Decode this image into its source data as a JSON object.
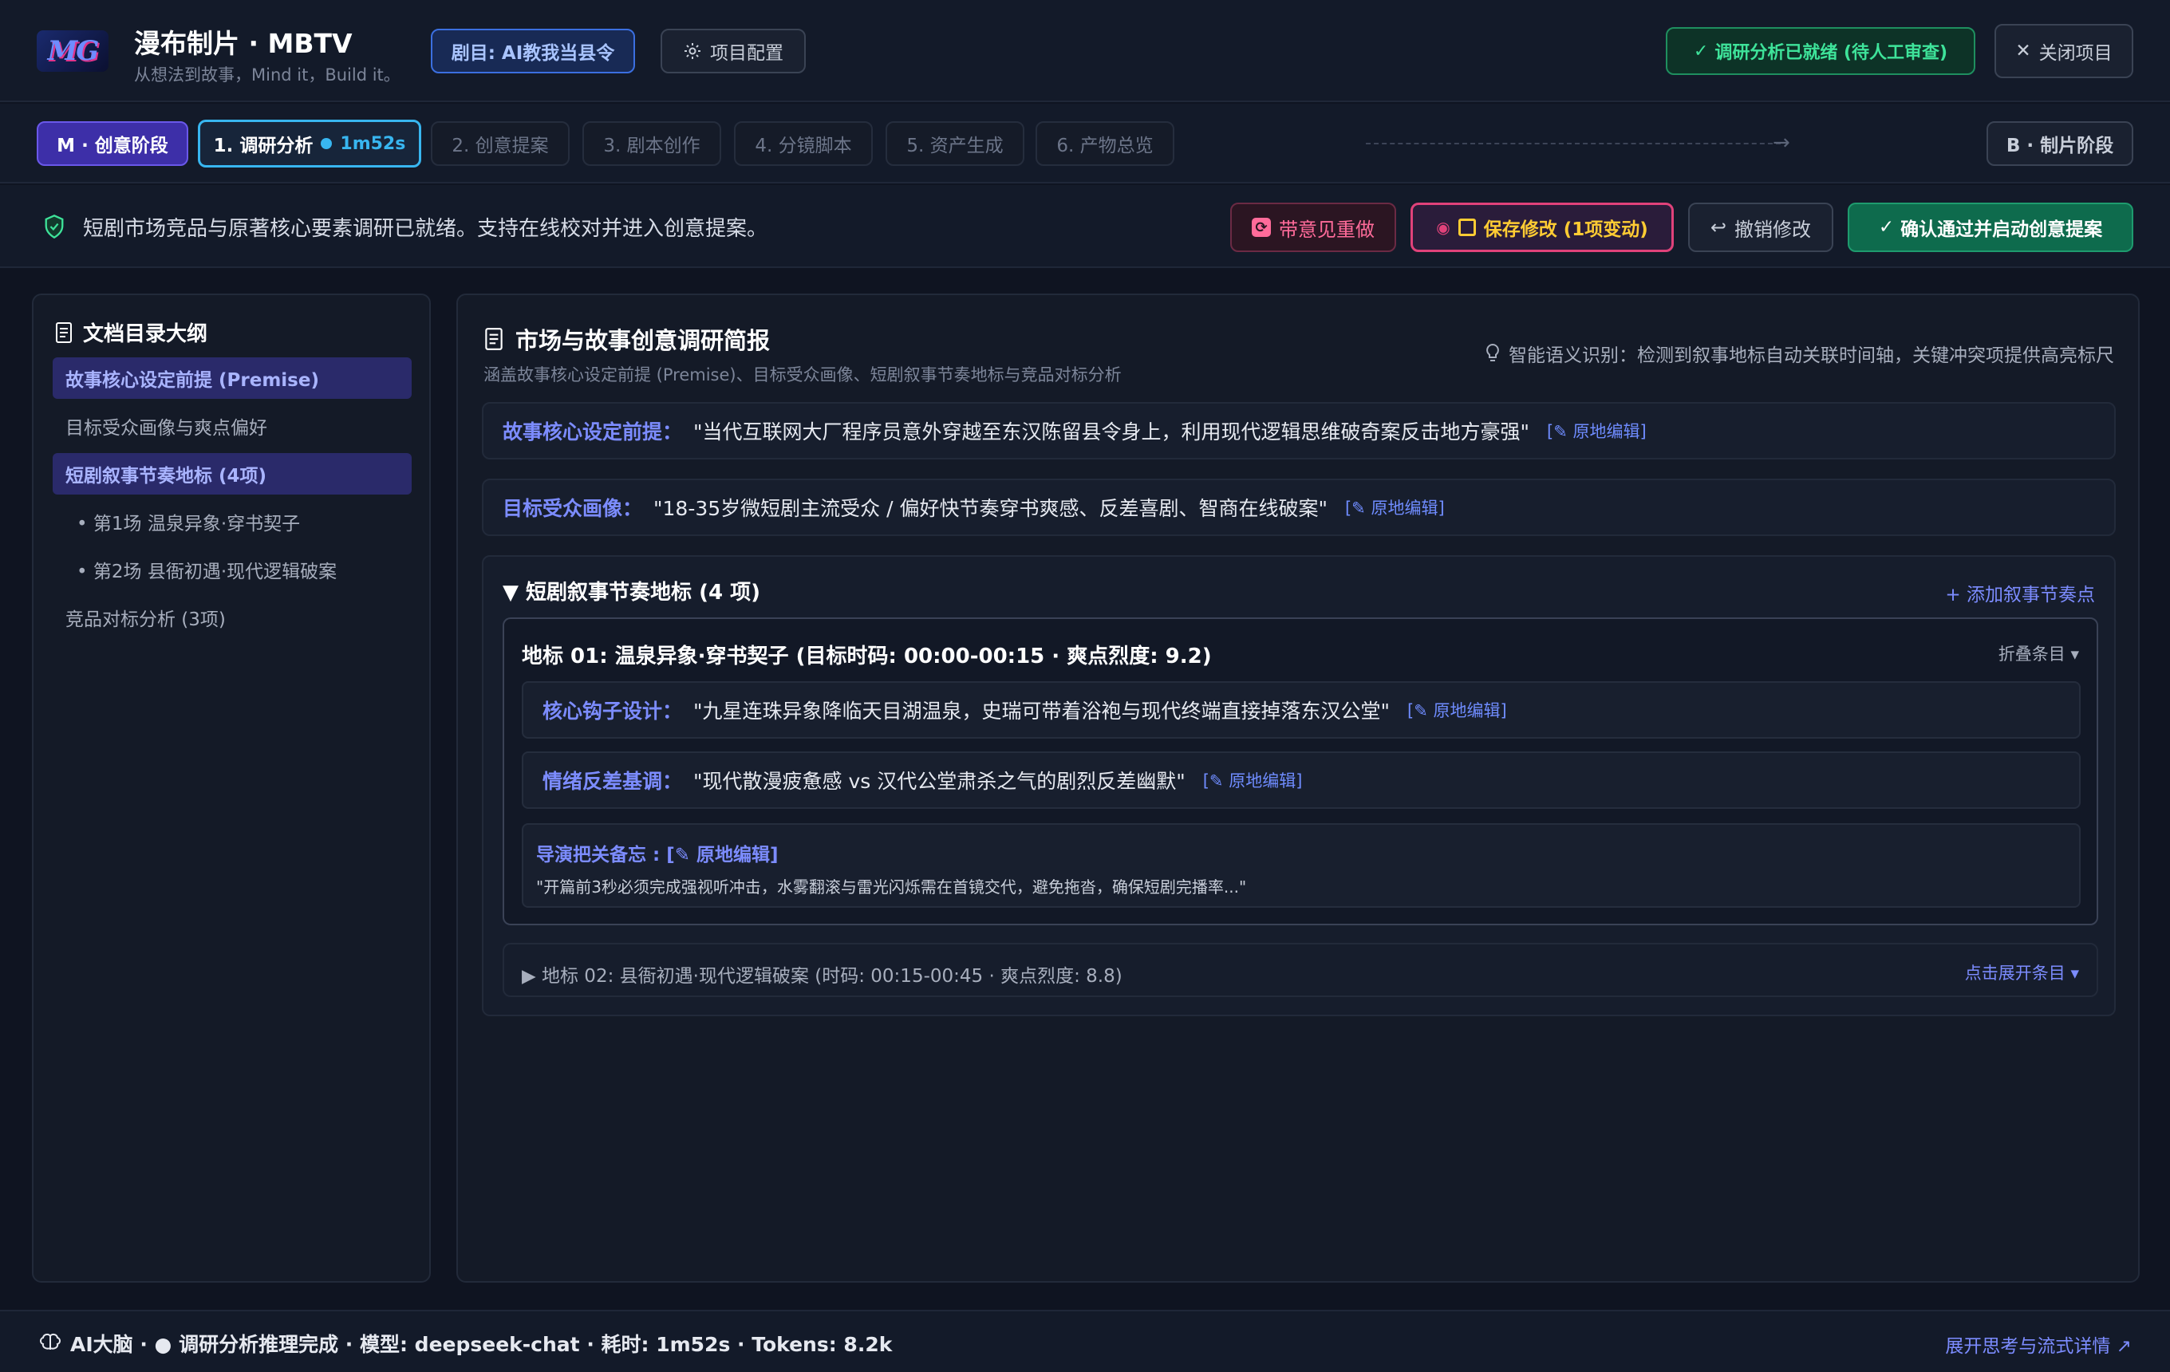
{
  "header": {
    "logo": "MG",
    "app_title": "漫布制片 · MBTV",
    "app_subtitle": "从想法到故事，Mind it，Build it。",
    "project_badge": "剧目: AI教我当县令",
    "config_label": "项目配置",
    "ready_badge": "调研分析已就绪 (待人工审查)",
    "close_label": "关闭项目"
  },
  "stages": {
    "m_stage": "M · 创意阶段",
    "active_step": {
      "label": "1. 调研分析",
      "timer": "1m52s"
    },
    "steps": [
      "2. 创意提案",
      "3. 剧本创作",
      "4. 分镜脚本",
      "5. 资产生成",
      "6. 产物总览"
    ],
    "b_stage": "B · 制片阶段"
  },
  "notice": {
    "text": "短剧市场竞品与原著核心要素调研已就绪。支持在线校对并进入创意提案。",
    "redo": "带意见重做",
    "save": "保存修改 (1项变动)",
    "undo": "撤销修改",
    "confirm": "确认通过并启动创意提案"
  },
  "sidebar": {
    "title": "文档目录大纲",
    "items": [
      "故事核心设定前提 (Premise)",
      "目标受众画像与爽点偏好",
      "短剧叙事节奏地标 (4项)",
      "• 第1场 温泉异象·穿书契子",
      "• 第2场 县衙初遇·现代逻辑破案",
      "竞品对标分析 (3项)"
    ]
  },
  "main": {
    "title": "市场与故事创意调研简报",
    "subtitle": "涵盖故事核心设定前提 (Premise)、目标受众画像、短剧叙事节奏地标与竞品对标分析",
    "ai_hint": "智能语义识别：检测到叙事地标自动关联时间轴，关键冲突项提供高亮标尺",
    "edit_label": "[✎ 原地编辑]",
    "premise": {
      "label": "故事核心设定前提：",
      "value": "\"当代互联网大厂程序员意外穿越至东汉陈留县令身上，利用现代逻辑思维破奇案反击地方豪强\""
    },
    "audience": {
      "label": "目标受众画像：",
      "value": "\"18-35岁微短剧主流受众 / 偏好快节奏穿书爽感、反差喜剧、智商在线破案\""
    },
    "beats": {
      "title": "▼ 短剧叙事节奏地标 (4 项)",
      "add": "+ 添加叙事节奏点",
      "beat1": {
        "title": "地标 01: 温泉异象·穿书契子 (目标时码: 00:00-00:15 · 爽点烈度: 9.2)",
        "collapse": "折叠条目 ▾",
        "hook_label": "核心钩子设计：",
        "hook_value": "\"九星连珠异象降临天目湖温泉，史瑞可带着浴袍与现代终端直接掉落东汉公堂\"",
        "contrast_label": "情绪反差基调：",
        "contrast_value": "\"现代散漫疲惫感 vs 汉代公堂肃杀之气的剧烈反差幽默\"",
        "memo_title": "导演把关备忘 : [✎ 原地编辑]",
        "memo_text": "\"开篇前3秒必须完成强视听冲击，水雾翻滚与雷光闪烁需在首镜交代，避免拖沓，确保短剧完播率...\""
      },
      "beat2": {
        "title": "▶ 地标 02: 县衙初遇·现代逻辑破案 (时码: 00:15-00:45 · 爽点烈度: 8.8)",
        "expand": "点击展开条目 ▾"
      }
    }
  },
  "footer": {
    "status": "AI大脑 · ● 调研分析推理完成 · 模型: deepseek-chat · 耗时: 1m52s · Tokens: 8.2k",
    "link": "展开思考与流式详情 ↗"
  },
  "colors": {
    "background": "#0f1421",
    "accent": "#7c8cff",
    "success": "#3ee39a",
    "warning": "#ffcc33",
    "danger": "#ff6b9a",
    "active_step": "#38b6f0"
  }
}
